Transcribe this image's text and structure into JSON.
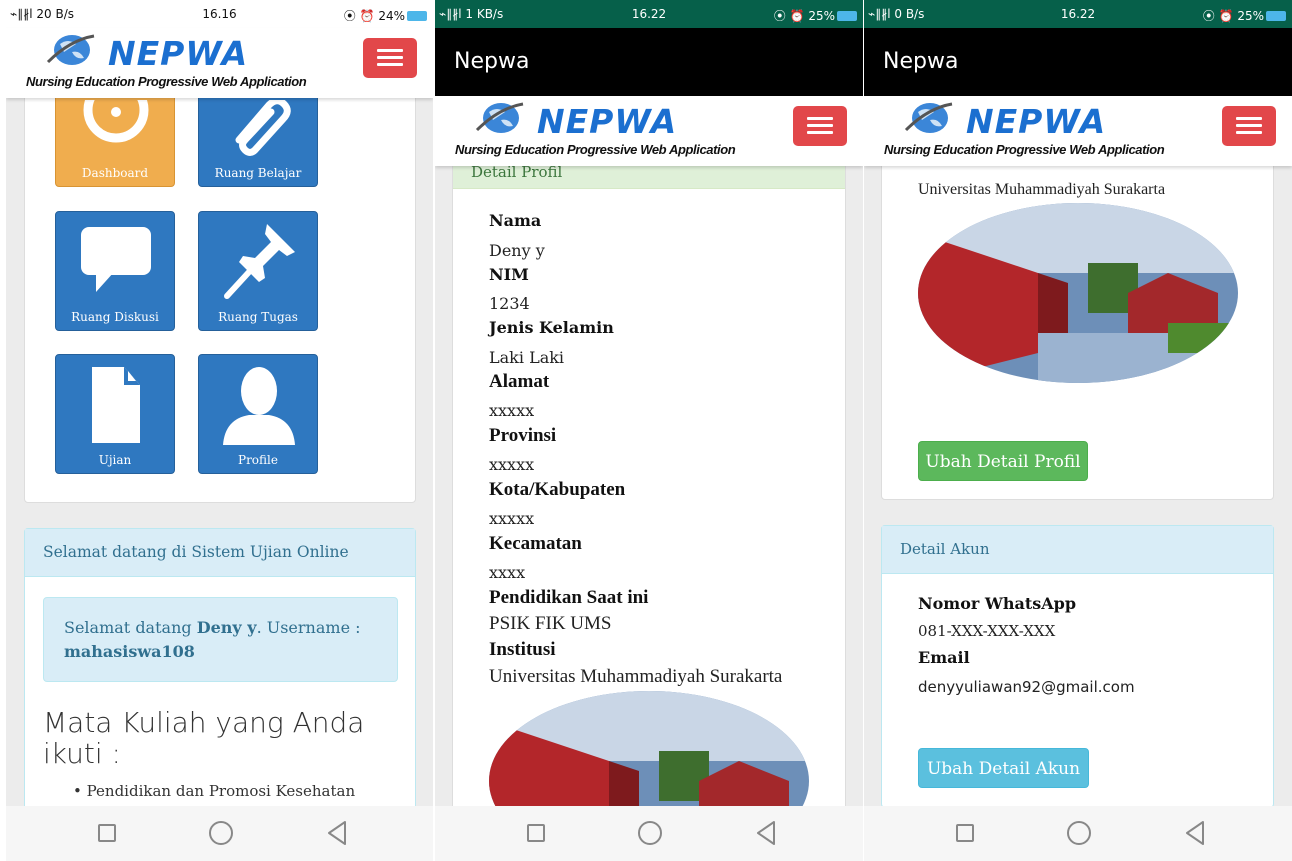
{
  "phone1": {
    "status": {
      "left": "⌁∥∦l 20 B/s",
      "time": "16.16",
      "right": "⦿ ⏰ 24%"
    },
    "brand": {
      "title": "NEPWA",
      "subtitle": "Nursing Education Progressive Web Application"
    },
    "tiles": [
      {
        "label": "Dashboard",
        "icon": "dashboard-icon"
      },
      {
        "label": "Ruang Belajar",
        "icon": "paperclip-icon"
      },
      {
        "label": "Ruang Diskusi",
        "icon": "chat-bubble-icon"
      },
      {
        "label": "Ruang Tugas",
        "icon": "pushpin-icon"
      },
      {
        "label": "Ujian",
        "icon": "document-icon"
      },
      {
        "label": "Profile",
        "icon": "user-icon"
      }
    ],
    "welcome_panel": {
      "heading": "Selamat datang di Sistem Ujian Online",
      "greeting_prefix": "Selamat datang",
      "user_name": "Deny y",
      "username_label": ". Username :",
      "username": "mahasiswa108",
      "courses_heading": "Mata Kuliah yang Anda ikuti :",
      "courses": [
        "Pendidikan dan Promosi Kesehatan"
      ]
    }
  },
  "phone2": {
    "status": {
      "left": "⌁∥∦l 1 KB/s",
      "time": "16.22",
      "right": "⦿ ⏰ 25%"
    },
    "appbar_title": "Nepwa",
    "brand": {
      "title": "NEPWA",
      "subtitle": "Nursing Education Progressive Web Application"
    },
    "panel_title": "Detail Profil",
    "fields": [
      {
        "label": "Nama",
        "value": "Deny y"
      },
      {
        "label": "NIM",
        "value": "1234"
      },
      {
        "label": "Jenis Kelamin",
        "value": "Laki Laki"
      },
      {
        "label": "Alamat",
        "value": "xxxxx"
      },
      {
        "label": "Provinsi",
        "value": "xxxxx"
      },
      {
        "label": "Kota/Kabupaten",
        "value": "xxxxx"
      },
      {
        "label": "Kecamatan",
        "value": "xxxx"
      },
      {
        "label": "Pendidikan Saat ini",
        "value": "PSIK FIK UMS"
      },
      {
        "label": "Institusi",
        "value": "Universitas Muhammadiyah Surakarta"
      }
    ]
  },
  "phone3": {
    "status": {
      "left": "⌁∥∦l 0 B/s",
      "time": "16.22",
      "right": "⦿ ⏰ 25%"
    },
    "appbar_title": "Nepwa",
    "brand": {
      "title": "NEPWA",
      "subtitle": "Nursing Education Progressive Web Application"
    },
    "institution": "Universitas Muhammadiyah Surakarta",
    "edit_profile_button": "Ubah Detail Profil",
    "account_panel": {
      "heading": "Detail Akun",
      "whatsapp_label": "Nomor WhatsApp",
      "whatsapp_value": "081-XXX-XXX-XXX",
      "email_label": "Email",
      "email_value": "denyyuliawan92@gmail.com",
      "edit_account_button": "Ubah Detail Akun"
    }
  },
  "colors": {
    "brand_blue": "#1b6fd0",
    "tile_blue": "#2f78c0",
    "hamburger_red": "#e2474a",
    "status_green": "#06604a",
    "info_bg": "#d9edf7",
    "success": "#5cb85c",
    "info_btn": "#5bc0de"
  }
}
